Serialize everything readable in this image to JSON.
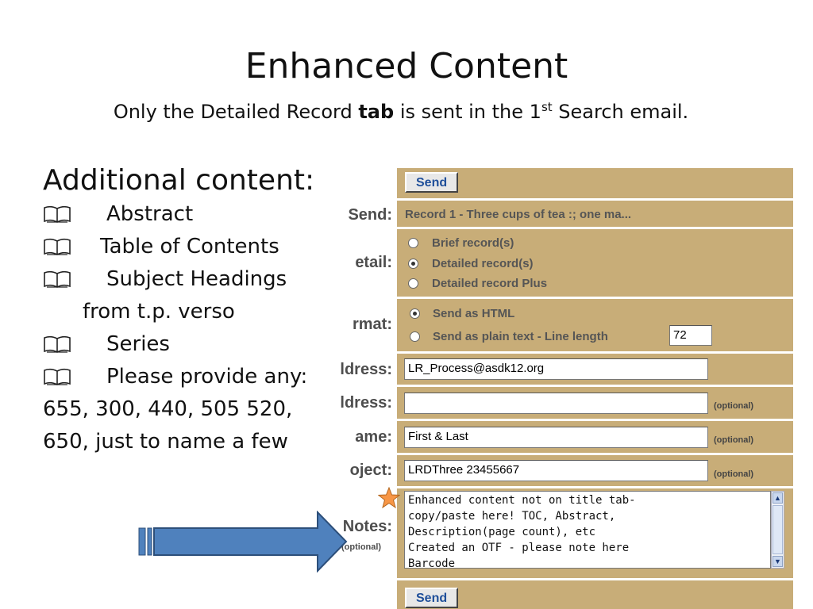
{
  "slide": {
    "title": "Enhanced Content",
    "subtitle_before": "Only the Detailed  Record ",
    "subtitle_bold": "tab",
    "subtitle_mid": " is sent in the 1",
    "subtitle_sup": "st",
    "subtitle_after": " Search email."
  },
  "left": {
    "heading": "Additional content:",
    "bullets": [
      "Abstract",
      "Table of Contents",
      "Subject Headings",
      "Series",
      "Please provide any:"
    ],
    "subject_cont": "from t.p. verso",
    "tail_lines": [
      "655, 300, 440, 505 520,",
      "650,  just to name a few"
    ],
    "bullet_icon": "open-book-icon"
  },
  "form": {
    "send_button": "Send",
    "labels": {
      "send": "Send:",
      "detail": "etail:",
      "format": "rmat:",
      "address1": "ldress:",
      "address2": "ldress:",
      "name": "ame:",
      "subject": "oject:",
      "notes": "Notes:",
      "notes_optional": "(optional)"
    },
    "record_text": "Record 1 - Three cups of tea :; one ma...",
    "detail_options": [
      {
        "label": "Brief record(s)",
        "selected": false
      },
      {
        "label": "Detailed record(s)",
        "selected": true
      },
      {
        "label": "Detailed record Plus",
        "selected": false
      }
    ],
    "format_options": [
      {
        "label": "Send as HTML",
        "selected": true
      },
      {
        "label": "Send as plain text -  Line length",
        "selected": false
      }
    ],
    "line_length": "72",
    "to_address": "LR_Process@asdk12.org",
    "from_address": "",
    "name_value": "First & Last",
    "subject_value": "LRDThree 23455667",
    "optional": "(optional)",
    "notes_value": "Enhanced content not on title tab-\ncopy/paste here! TOC, Abstract,\nDescription(page count), etc\nCreated an OTF - please note here\nBarcode"
  },
  "colors": {
    "panel": "#c8ad78",
    "label_text": "#4e4e4e",
    "button_text": "#1f4f9a",
    "arrow_fill": "#4f81bd",
    "star_fill": "#f79646"
  }
}
